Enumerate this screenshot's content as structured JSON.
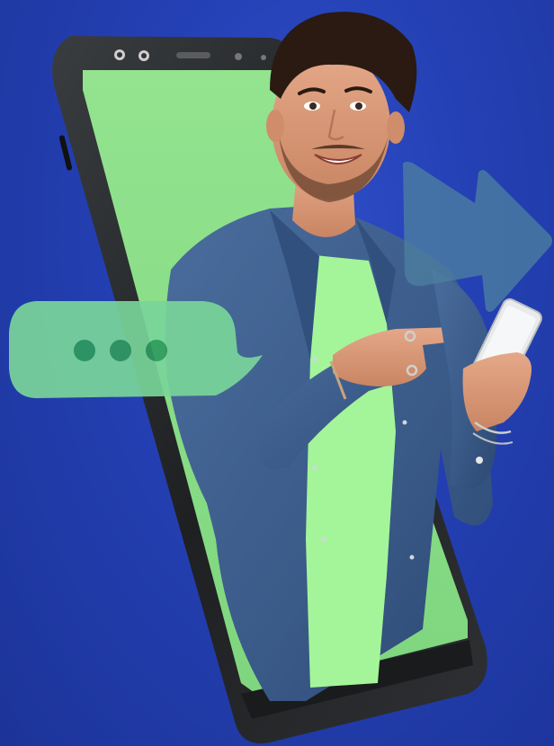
{
  "scene": {
    "description_elements": {
      "background": "blue-gradient-backdrop",
      "phone": "smartphone-frame",
      "person": "smiling-man-with-phone",
      "bubble": "typing-chat-bubble-icon",
      "arrow": "forward-arrow-icon"
    },
    "colors": {
      "background": "#2440b4",
      "background_dark": "#1c3499",
      "screen_green": "#8fe08d",
      "shirt_green": "#a4f59a",
      "denim": "#3d5f8f",
      "denim_dark": "#2c4872",
      "phone_body": "#2a2c2e",
      "phone_bezel": "#0f1011",
      "skin": "#d99a7a",
      "hair": "#2a1a12",
      "bubble": "#79d59a",
      "bubble_dot": "#2f9a5f",
      "arrow": "#4d7fa0"
    },
    "typing_dots": 3
  }
}
